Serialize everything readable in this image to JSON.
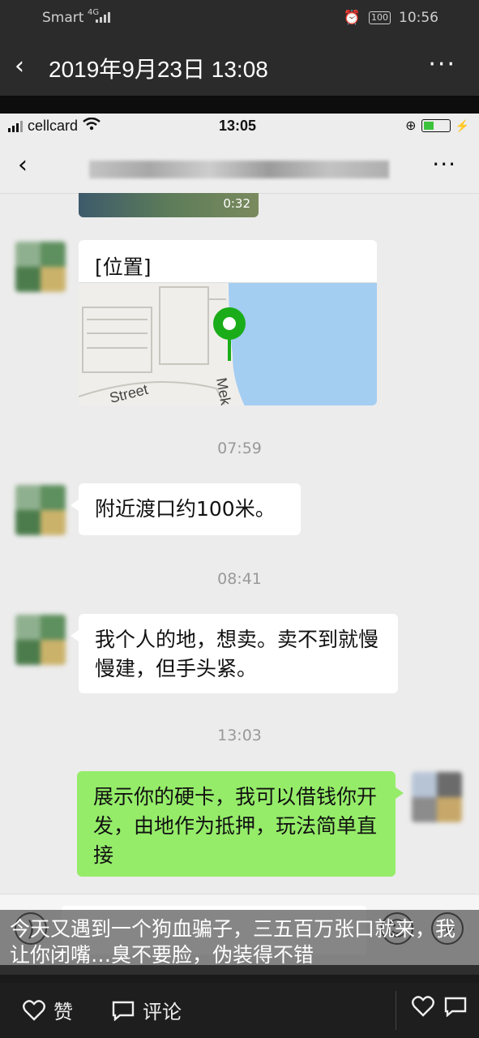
{
  "outer": {
    "carrier": "Smart",
    "network": "4G",
    "battery": "100",
    "time": "10:56",
    "title": "2019年9月23日 13:08",
    "more": "···"
  },
  "inner": {
    "carrier": "cellcard",
    "time": "13:05",
    "more": "···",
    "video_duration": "0:32",
    "location_label": "[位置]",
    "map_street": "Street",
    "map_street2": "Mek",
    "messages": [
      {
        "time": "07:59",
        "text": "附近渡口约100米。"
      },
      {
        "time": "08:41",
        "text": "我个人的地，想卖。卖不到就慢慢建，但手头紧。"
      },
      {
        "time": "13:03",
        "text": "展示你的硬卡，我可以借钱你开发，由地作为抵押，玩法简单直接"
      }
    ]
  },
  "caption": "今天又遇到一个狗血骗子，三五百万张口就来，我让你闭嘴…臭不要脸，伪装得不错",
  "bottom": {
    "like_label": "赞",
    "comment_label": "评论"
  }
}
